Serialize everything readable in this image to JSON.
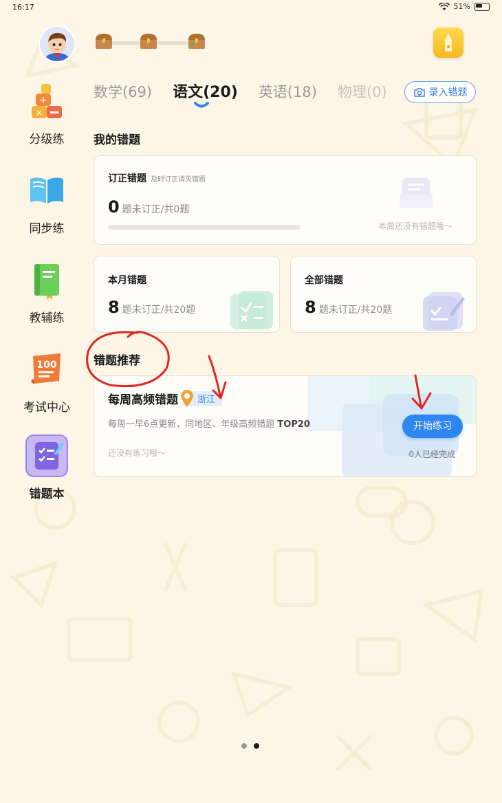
{
  "status_bar": {
    "time": "16:17",
    "battery": "51%"
  },
  "sidebar": {
    "items": [
      {
        "label": "分级练",
        "icon": "blocks-icon"
      },
      {
        "label": "同步练",
        "icon": "open-book-icon"
      },
      {
        "label": "教辅练",
        "icon": "green-book-icon"
      },
      {
        "label": "考试中心",
        "icon": "score-100-icon"
      },
      {
        "label": "错题本",
        "icon": "checklist-icon",
        "active": true
      }
    ]
  },
  "tabs": [
    {
      "label": "数学(69)"
    },
    {
      "label": "语文(20)",
      "active": true
    },
    {
      "label": "英语(18)"
    },
    {
      "label": "物理(0)"
    }
  ],
  "record_button": {
    "label": "录入错题"
  },
  "my_mistakes": {
    "section_title": "我的错题",
    "correction": {
      "title": "订正错题",
      "subtitle": "及时订正消灭错题",
      "count": "0",
      "stat": "题未订正/共0题",
      "progress": 0,
      "empty_note": "本周还没有错题哦～"
    },
    "monthly": {
      "title": "本月错题",
      "count": "8",
      "stat": "题未订正/共20题"
    },
    "all": {
      "title": "全部错题",
      "count": "8",
      "stat": "题未订正/共20题"
    }
  },
  "recommend": {
    "section_title": "错题推荐",
    "weekly": {
      "title": "每周高频错题",
      "region": "浙江",
      "desc_prefix": "每周一早6点更新，同地区、年级高频错题 ",
      "desc_bold": "TOP20",
      "empty_note": "还没有练习哦～",
      "button": "开始练习",
      "completed": "0人已经完成"
    }
  },
  "colors": {
    "background": "#fdf6e6",
    "accent_blue": "#2f86f0",
    "annotation_red": "#e0271f"
  },
  "pager": {
    "total": 2,
    "active_index": 1
  }
}
